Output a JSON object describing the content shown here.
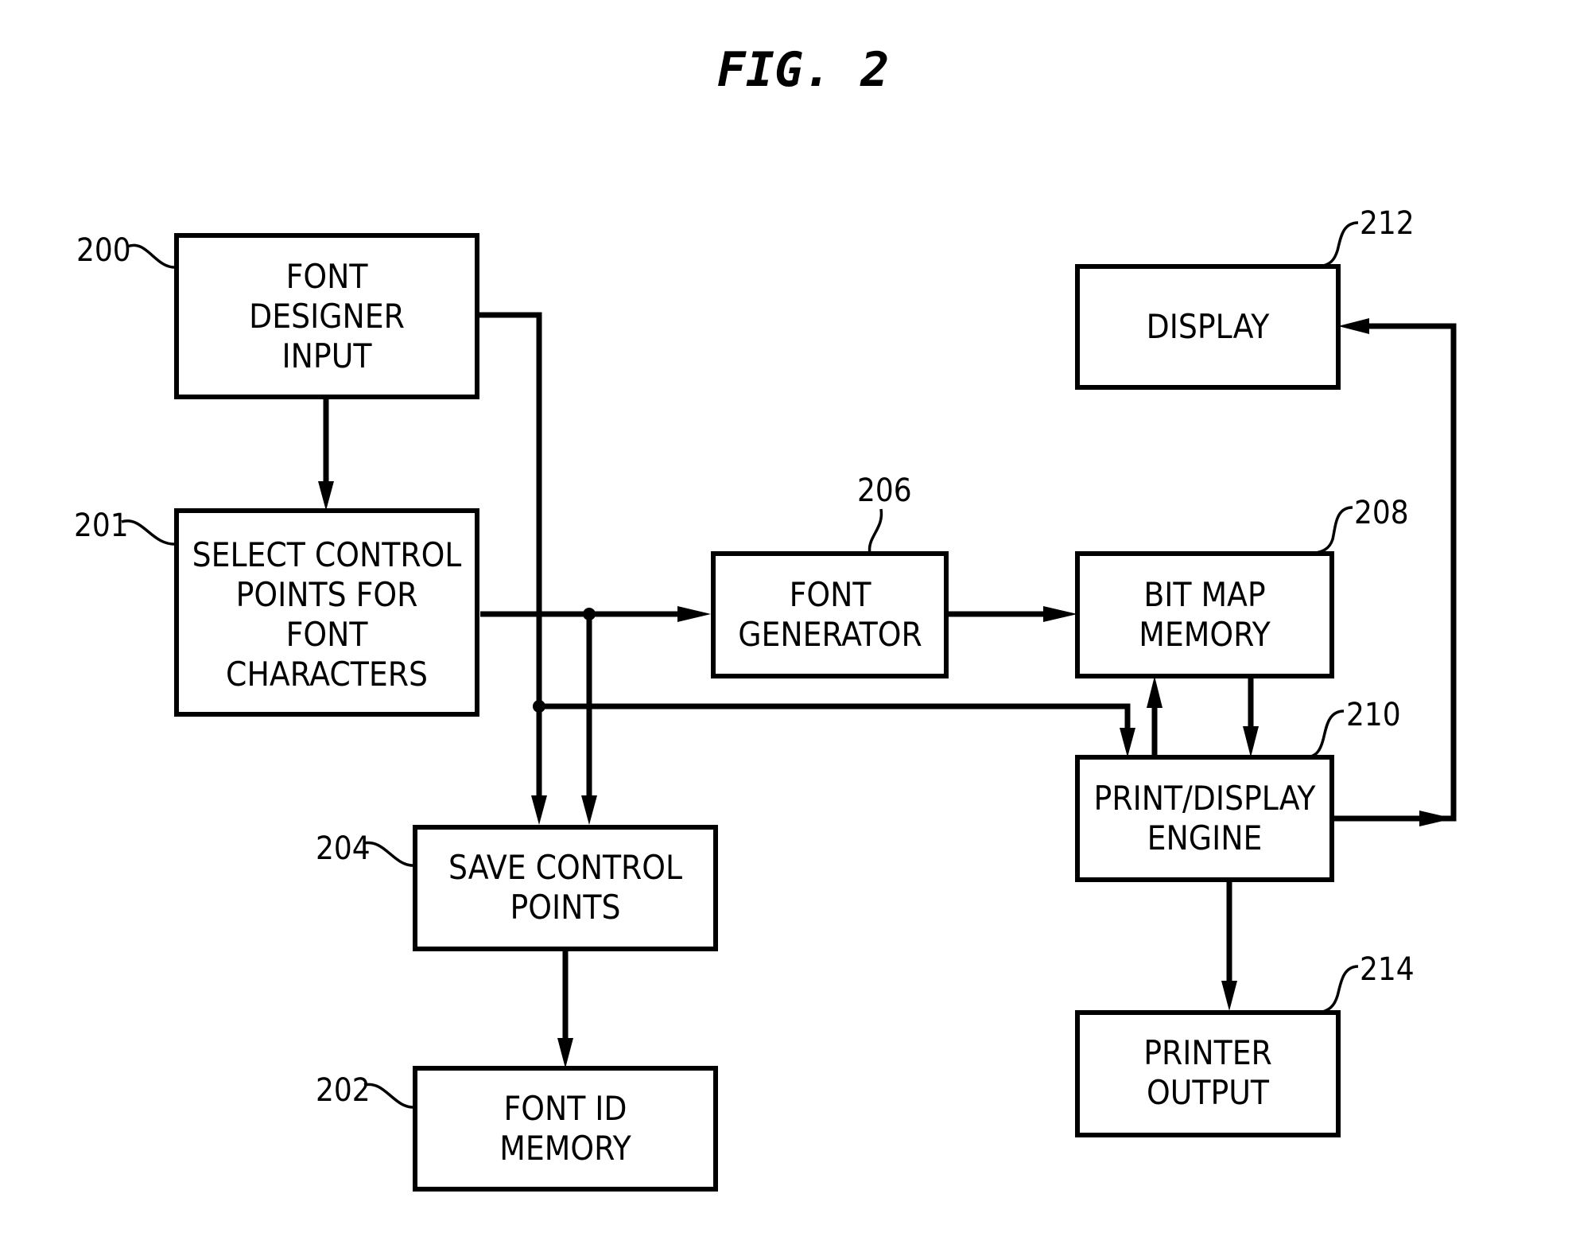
{
  "figure": {
    "title": "FIG. 2"
  },
  "blocks": {
    "font_designer_input": {
      "ref": "200",
      "lines": [
        "FONT",
        "DESIGNER",
        "INPUT"
      ]
    },
    "select_control_points": {
      "ref": "201",
      "lines": [
        "SELECT CONTROL",
        "POINTS FOR",
        "FONT",
        "CHARACTERS"
      ]
    },
    "font_id_memory": {
      "ref": "202",
      "lines": [
        "FONT ID",
        "MEMORY"
      ]
    },
    "save_control_points": {
      "ref": "204",
      "lines": [
        "SAVE CONTROL",
        "POINTS"
      ]
    },
    "font_generator": {
      "ref": "206",
      "lines": [
        "FONT",
        "GENERATOR"
      ]
    },
    "bit_map_memory": {
      "ref": "208",
      "lines": [
        "BIT MAP",
        "MEMORY"
      ]
    },
    "print_display_engine": {
      "ref": "210",
      "lines": [
        "PRINT/DISPLAY",
        "ENGINE"
      ]
    },
    "display": {
      "ref": "212",
      "lines": [
        "DISPLAY"
      ]
    },
    "printer_output": {
      "ref": "214",
      "lines": [
        "PRINTER",
        "OUTPUT"
      ]
    }
  },
  "connections": [
    {
      "from": "200",
      "to": "201"
    },
    {
      "from": "200",
      "to": "204"
    },
    {
      "from": "200",
      "to": "210"
    },
    {
      "from": "201",
      "to": "206"
    },
    {
      "from": "201",
      "to": "204"
    },
    {
      "from": "204",
      "to": "202"
    },
    {
      "from": "206",
      "to": "208"
    },
    {
      "from": "210",
      "to": "208"
    },
    {
      "from": "208",
      "to": "210"
    },
    {
      "from": "210",
      "to": "212"
    },
    {
      "from": "210",
      "to": "214"
    }
  ]
}
